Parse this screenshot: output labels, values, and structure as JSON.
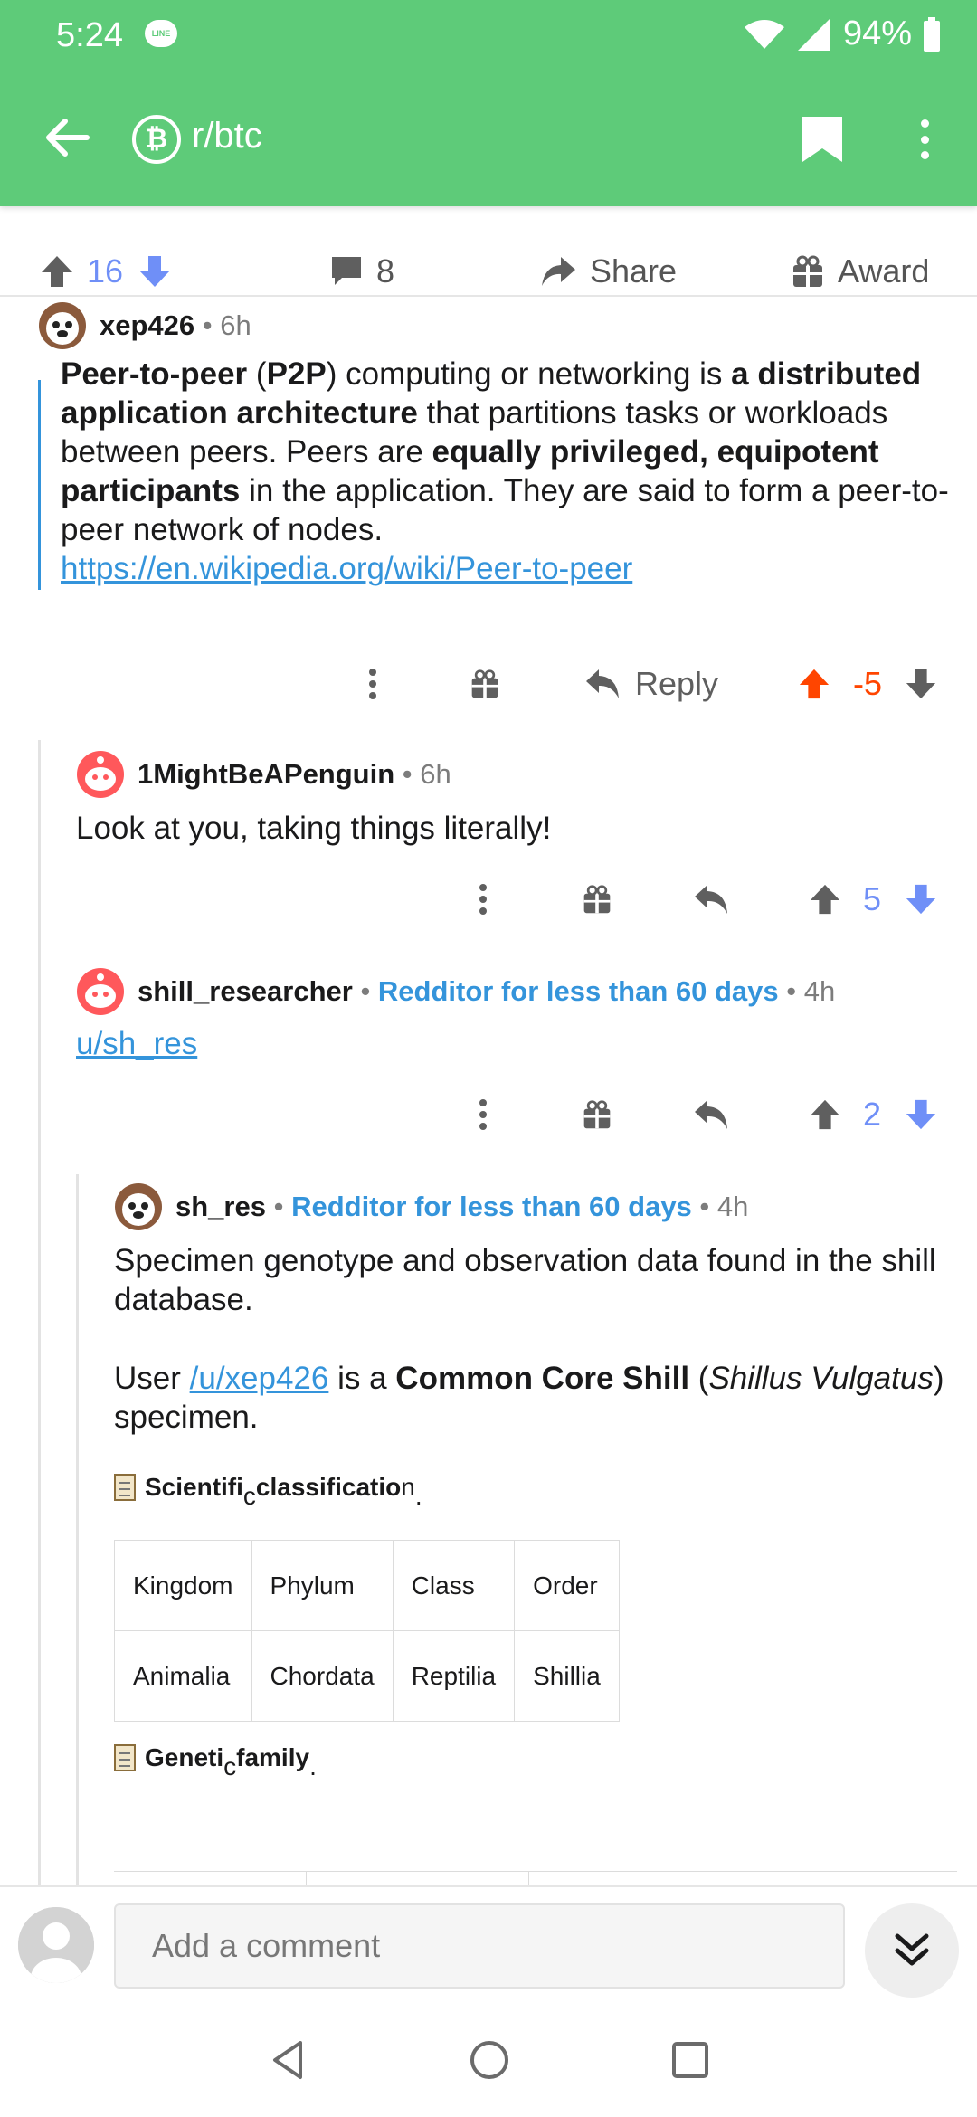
{
  "status_bar": {
    "time": "5:24",
    "line_badge": "LINE",
    "battery": "94%"
  },
  "app_bar": {
    "subreddit": "r/btc",
    "sub_icon": "₿",
    "icons": [
      "back-arrow-icon",
      "bookmark-icon",
      "more-vert-icon"
    ]
  },
  "post_actions": {
    "upvotes": "16",
    "comments": "8",
    "share_label": "Share",
    "award_label": "Award"
  },
  "comments": [
    {
      "username": "xep426",
      "time": "6h",
      "body": {
        "p1_b1": "Peer-to-peer",
        "p1_t1": " (",
        "p1_b2": "P2P",
        "p1_t2": ") computing or networking is ",
        "p1_b3": "a distributed application architecture",
        "p1_t3": " that partitions tasks or workloads between peers. Peers  are ",
        "p1_b4": "equally privileged, equipotent participants",
        "p1_t4": " in the application. They  are said to form a peer-to-peer network of nodes.",
        "link": "https://en.wikipedia.org/wiki/Peer-to-peer"
      },
      "reply_label": "Reply",
      "score": "-5"
    },
    {
      "username": "1MightBeAPenguin",
      "time": "6h",
      "body": "Look at you, taking things literally!",
      "score": "5"
    },
    {
      "username": "shill_researcher",
      "flair": "Redditor for less than 60 days",
      "time": "4h",
      "body_link": "u/sh_res",
      "score": "2"
    },
    {
      "username": "sh_res",
      "flair": "Redditor for less than 60 days",
      "time": "4h",
      "p1": "Specimen genotype and observation data found in the shill database.",
      "p2_t1": "User ",
      "p2_link": "/u/xep426",
      "p2_t2": " is a ",
      "p2_b1": "Common Core Shill",
      "p2_t3": " (",
      "p2_i1": "Shillus Vulgatus",
      "p2_t4": ") specimen.",
      "section1_a": "Scientifi",
      "section1_sub": "c",
      "section1_b": " classificatio",
      "section1_c": "n",
      "section1_dot": ".",
      "table_header": [
        "Kingdom",
        "Phylum",
        "Class",
        "Order"
      ],
      "table_row": [
        "Animalia",
        "Chordata",
        "Reptilia",
        "Shillia"
      ],
      "section2_a": "Geneti",
      "section2_sub": "c",
      "section2_b": " family",
      "section2_dot": "."
    }
  ],
  "bottom_bar": {
    "placeholder": "Add a comment"
  },
  "colors": {
    "header_green": "#5ecb79",
    "upvote_orange": "#ff4500",
    "blue": "#6f8ff7",
    "link_blue": "#3494db"
  }
}
